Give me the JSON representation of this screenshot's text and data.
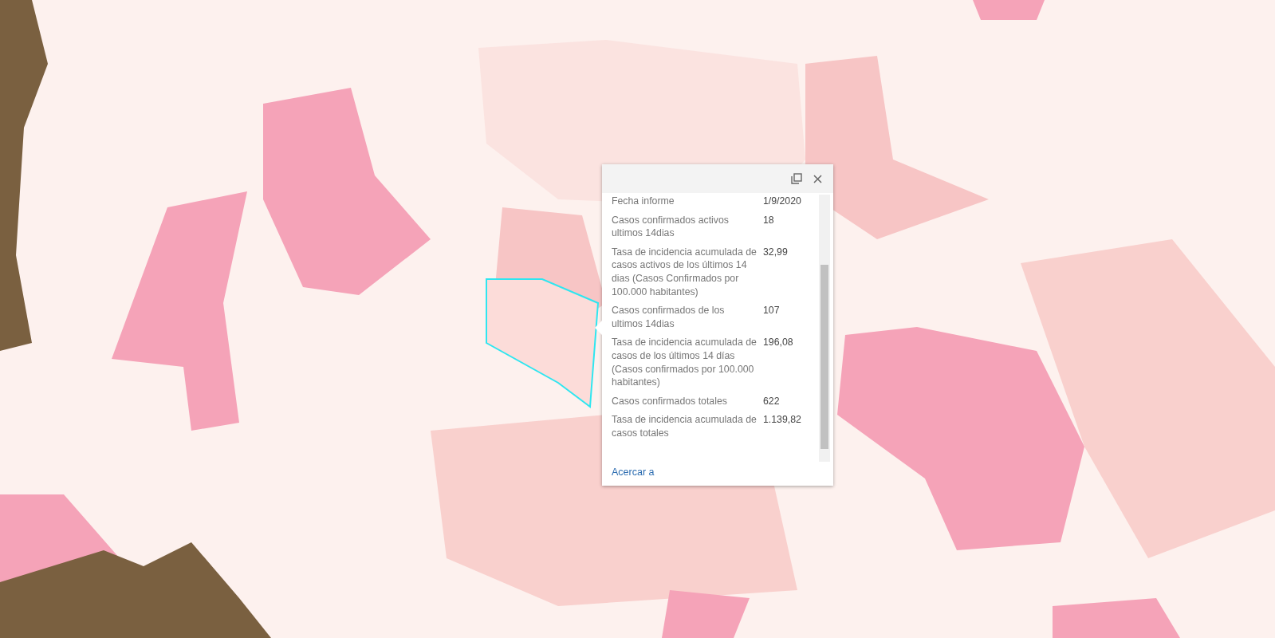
{
  "popup": {
    "fields": [
      {
        "label": "Fecha informe",
        "value": "1/9/2020"
      },
      {
        "label": "Casos confirmados activos ultimos 14dias",
        "value": "18"
      },
      {
        "label": "Tasa de incidencia acumulada de casos activos de los últimos 14 dias (Casos Confirmados por 100.000 habitantes)",
        "value": "32,99"
      },
      {
        "label": "Casos confirmados de los ultimos 14dias",
        "value": "107"
      },
      {
        "label": "Tasa de incidencia acumulada de casos de los últimos 14 días (Casos confirmados por 100.000 habitantes)",
        "value": "196,08"
      },
      {
        "label": "Casos confirmados totales",
        "value": "622"
      },
      {
        "label": "Tasa de incidencia acumulada de casos totales",
        "value": "1.139,82"
      }
    ],
    "link": "Acercar a"
  }
}
